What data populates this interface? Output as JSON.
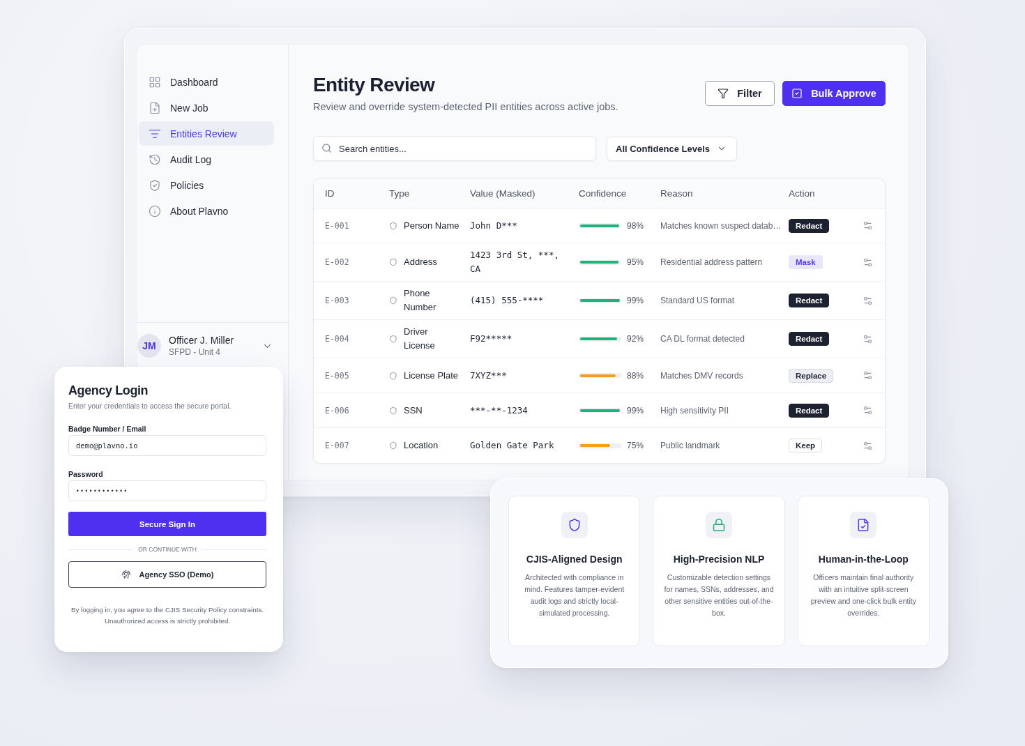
{
  "sidebar": {
    "items": [
      {
        "label": "Dashboard",
        "selected": false
      },
      {
        "label": "New Job",
        "selected": false
      },
      {
        "label": "Entities Review",
        "selected": true
      },
      {
        "label": "Audit Log",
        "selected": false
      },
      {
        "label": "Policies",
        "selected": false
      },
      {
        "label": "About Plavno",
        "selected": false
      }
    ],
    "user": {
      "initials": "JM",
      "name": "Officer J. Miller",
      "unit": "SFPD - Unit 4"
    }
  },
  "header": {
    "title": "Entity Review",
    "subtitle": "Review and override system-detected PII entities across active jobs.",
    "buttons": [
      {
        "label": "Filter",
        "kind": "outline"
      },
      {
        "label": "Bulk Approve",
        "kind": "primary"
      }
    ]
  },
  "search": {
    "placeholder": "Search entities..."
  },
  "confidence_filter": {
    "value": "All Confidence Levels"
  },
  "table": {
    "columns": [
      "ID",
      "Type",
      "Value (Masked)",
      "Confidence",
      "Reason",
      "Action"
    ],
    "rows": [
      {
        "id": "E-001",
        "type": "Person Name",
        "value": "John D***",
        "level": 0.98,
        "color": "#1fb27a",
        "reading": "98%",
        "reason": "Matches known suspect datab…",
        "action": {
          "label": "Redact",
          "kind": "redact"
        }
      },
      {
        "id": "E-002",
        "type": "Address",
        "value": "1423 3rd St, ***, CA",
        "level": 0.95,
        "color": "#1fb27a",
        "reading": "95%",
        "reason": "Residential address pattern",
        "action": {
          "label": "Mask",
          "kind": "mask"
        }
      },
      {
        "id": "E-003",
        "type": "Phone Number",
        "value": "(415) 555-****",
        "level": 0.99,
        "color": "#1fb27a",
        "reading": "99%",
        "reason": "Standard US format",
        "action": {
          "label": "Redact",
          "kind": "redact"
        }
      },
      {
        "id": "E-004",
        "type": "Driver License",
        "value": "F92*****",
        "level": 0.92,
        "color": "#1fb27a",
        "reading": "92%",
        "reason": "CA DL format detected",
        "action": {
          "label": "Redact",
          "kind": "redact"
        }
      },
      {
        "id": "E-005",
        "type": "License Plate",
        "value": "7XYZ***",
        "level": 0.88,
        "color": "#f59e1b",
        "reading": "88%",
        "reason": "Matches DMV records",
        "action": {
          "label": "Replace",
          "kind": "replace"
        }
      },
      {
        "id": "E-006",
        "type": "SSN",
        "value": "***-**-1234",
        "level": 0.99,
        "color": "#1fb27a",
        "reading": "99%",
        "reason": "High sensitivity PII",
        "action": {
          "label": "Redact",
          "kind": "redact"
        }
      },
      {
        "id": "E-007",
        "type": "Location",
        "value": "Golden Gate Park",
        "level": 0.75,
        "color": "#f59e1b",
        "reading": "75%",
        "reason": "Public landmark",
        "action": {
          "label": "Keep",
          "kind": "keep"
        }
      }
    ]
  },
  "login": {
    "title": "Agency Login",
    "subtitle": "Enter your credentials to access the secure portal.",
    "fields": [
      {
        "label": "Badge Number / Email",
        "value": "demo@plavno.io",
        "kind": "text"
      },
      {
        "label": "Password",
        "value": "••••••••••••",
        "kind": "password"
      }
    ],
    "submit": "Secure Sign In",
    "divider": "OR CONTINUE WITH",
    "sso": "Agency SSO (Demo)",
    "footer": "By logging in, you agree to the CJIS Security Policy constraints. Unauthorized access is strictly prohibited."
  },
  "features": [
    {
      "title": "CJIS-Aligned Design",
      "description": "Architected with compliance in mind. Features tamper-evident audit logs and strictly local-simulated processing."
    },
    {
      "title": "High-Precision NLP",
      "description": "Customizable detection settings for names, SSNs, addresses, and other sensitive entities out-of-the-box."
    },
    {
      "title": "Human-in-the-Loop",
      "description": "Officers maintain final authority with an intuitive split-screen preview and one-click bulk entity overrides."
    }
  ]
}
